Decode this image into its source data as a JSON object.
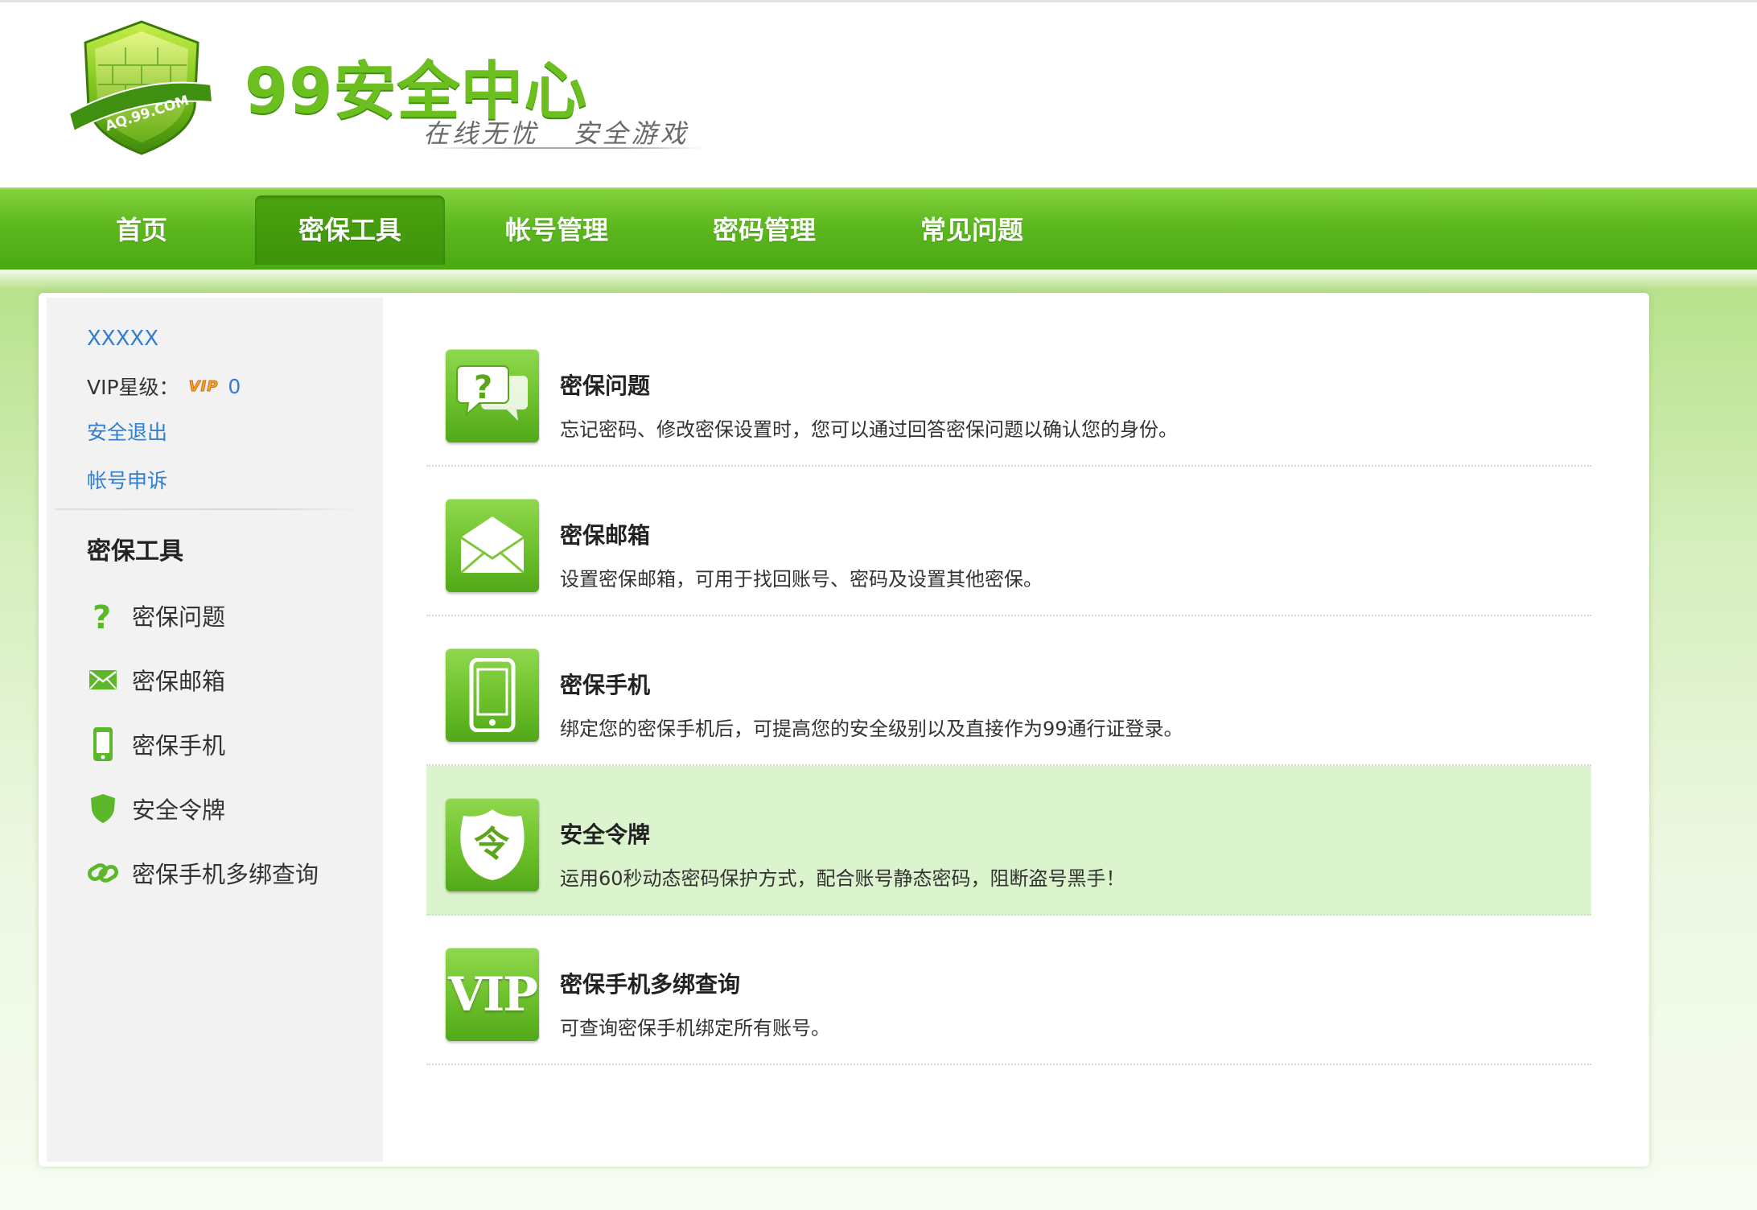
{
  "header": {
    "site_title": "99安全中心",
    "slogan": "在线无忧   安全游戏",
    "logo_text": "AQ.99.COM"
  },
  "nav": {
    "items": [
      {
        "label": "首页",
        "active": false
      },
      {
        "label": "密保工具",
        "active": true
      },
      {
        "label": "帐号管理",
        "active": false
      },
      {
        "label": "密码管理",
        "active": false
      },
      {
        "label": "常见问题",
        "active": false
      }
    ]
  },
  "sidebar": {
    "username": "XXXXX",
    "vip_label": "VIP星级：",
    "vip_badge": "VIP",
    "vip_level": "0",
    "logout": "安全退出",
    "appeal": "帐号申诉",
    "heading": "密保工具",
    "items": [
      {
        "label": "密保问题",
        "icon": "question-icon"
      },
      {
        "label": "密保邮箱",
        "icon": "mail-icon"
      },
      {
        "label": "密保手机",
        "icon": "phone-icon"
      },
      {
        "label": "安全令牌",
        "icon": "shield-icon"
      },
      {
        "label": "密保手机多绑查询",
        "icon": "link-icon"
      }
    ]
  },
  "tools": [
    {
      "title": "密保问题",
      "desc": "忘记密码、修改密保设置时，您可以通过回答密保问题以确认您的身份。",
      "icon": "question-bubble-icon",
      "highlighted": false
    },
    {
      "title": "密保邮箱",
      "desc": "设置密保邮箱，可用于找回账号、密码及设置其他密保。",
      "icon": "envelope-icon",
      "highlighted": false
    },
    {
      "title": "密保手机",
      "desc": "绑定您的密保手机后，可提高您的安全级别以及直接作为99通行证登录。",
      "icon": "mobile-phone-icon",
      "highlighted": false
    },
    {
      "title": "安全令牌",
      "desc": "运用60秒动态密码保护方式，配合账号静态密码，阻断盗号黑手！",
      "icon": "token-shield-icon",
      "highlighted": true,
      "icon_glyph": "令"
    },
    {
      "title": "密保手机多绑查询",
      "desc": "可查询密保手机绑定所有账号。",
      "icon": "vip-icon",
      "highlighted": false,
      "icon_glyph": "VIP"
    }
  ],
  "colors": {
    "brand_green": "#5db81f",
    "link_blue": "#2f7ed0",
    "highlight_row": "#dbf4cd"
  }
}
